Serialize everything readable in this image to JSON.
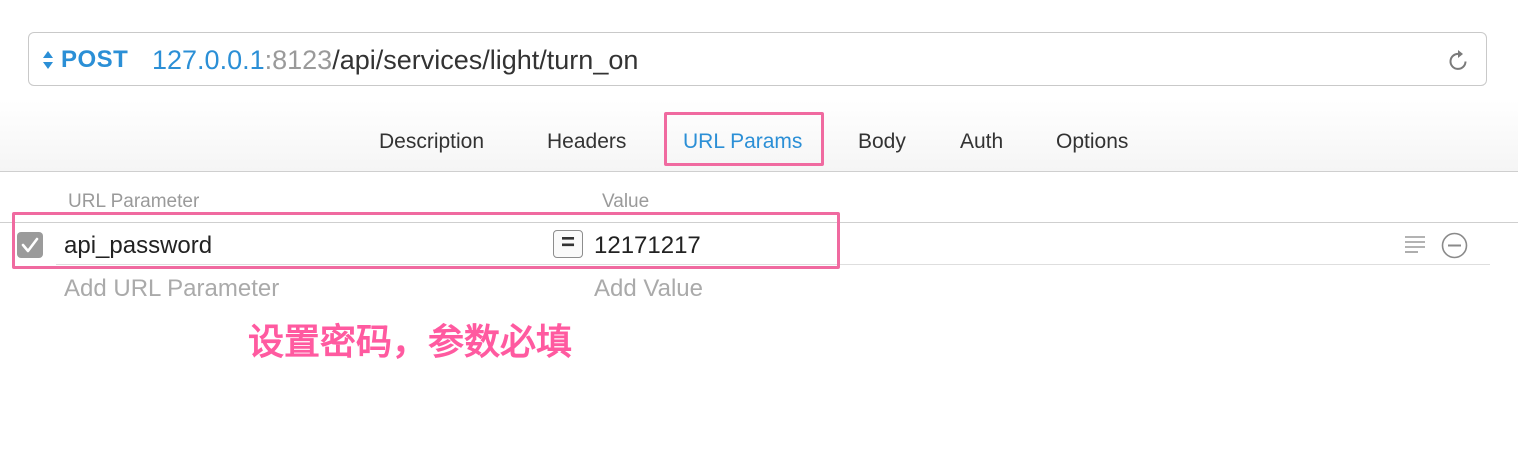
{
  "url_bar": {
    "method": "POST",
    "host": "127.0.0.1",
    "colon": ":",
    "port": "8123",
    "path": "/api/services/light/turn_on",
    "method_icon": "up-down-arrows-icon",
    "reload_icon": "reload-icon"
  },
  "tabs": [
    {
      "label": "Description",
      "active": false
    },
    {
      "label": "Headers",
      "active": false
    },
    {
      "label": "URL Params",
      "active": true
    },
    {
      "label": "Body",
      "active": false
    },
    {
      "label": "Auth",
      "active": false
    },
    {
      "label": "Options",
      "active": false
    }
  ],
  "params": {
    "header_name": "URL Parameter",
    "header_value": "Value",
    "rows": [
      {
        "name": "api_password",
        "operator": "=",
        "value": "12171217",
        "enabled": true
      }
    ],
    "add_name_placeholder": "Add URL Parameter",
    "add_value_placeholder": "Add Value",
    "row_icons": [
      "lines-icon",
      "remove-icon"
    ]
  },
  "annotation": {
    "text": "设置密码，参数必填"
  },
  "colors": {
    "accent": "#2b8fd6",
    "highlight": "#f06aa0",
    "annotation": "#ff5aa0"
  }
}
